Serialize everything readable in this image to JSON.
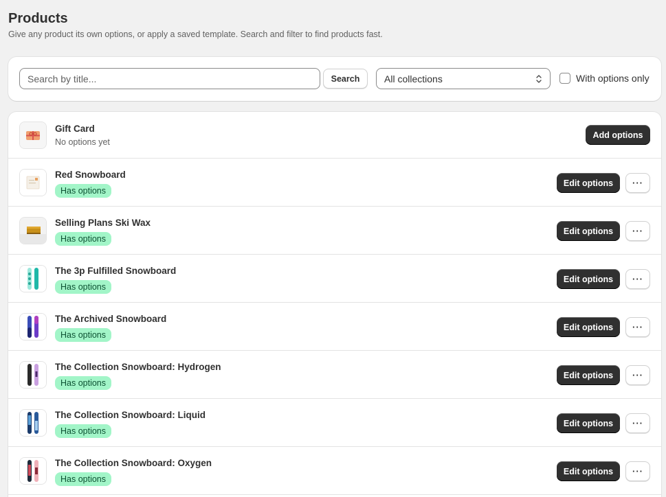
{
  "page": {
    "title": "Products",
    "subtitle": "Give any product its own options, or apply a saved template. Search and filter to find products fast."
  },
  "filters": {
    "search_placeholder": "Search by title...",
    "search_value": "",
    "search_button": "Search",
    "collection_selected": "All collections",
    "checkbox_label": "With options only",
    "checkbox_checked": false
  },
  "icons": {
    "select": "select-chevrons-icon",
    "more": "more-horizontal-icon"
  },
  "products": [
    {
      "title": "Gift Card",
      "status": "No options yet",
      "has_options": false,
      "action": "Add options",
      "thumb": "gift-card"
    },
    {
      "title": "Red Snowboard",
      "status": "Has options",
      "has_options": true,
      "action": "Edit options",
      "more": "···",
      "thumb": "red-snowboard"
    },
    {
      "title": "Selling Plans Ski Wax",
      "status": "Has options",
      "has_options": true,
      "action": "Edit options",
      "more": "···",
      "thumb": "ski-wax"
    },
    {
      "title": "The 3p Fulfilled Snowboard",
      "status": "Has options",
      "has_options": true,
      "action": "Edit options",
      "more": "···",
      "thumb": "3p-snowboard"
    },
    {
      "title": "The Archived Snowboard",
      "status": "Has options",
      "has_options": true,
      "action": "Edit options",
      "more": "···",
      "thumb": "archived-snowboard"
    },
    {
      "title": "The Collection Snowboard: Hydrogen",
      "status": "Has options",
      "has_options": true,
      "action": "Edit options",
      "more": "···",
      "thumb": "hydrogen-snowboard"
    },
    {
      "title": "The Collection Snowboard: Liquid",
      "status": "Has options",
      "has_options": true,
      "action": "Edit options",
      "more": "···",
      "thumb": "liquid-snowboard"
    },
    {
      "title": "The Collection Snowboard: Oxygen",
      "status": "Has options",
      "has_options": true,
      "action": "Edit options",
      "more": "···",
      "thumb": "oxygen-snowboard"
    }
  ],
  "colors": {
    "badge_bg": "#a2f5c8",
    "badge_text": "#0c5132",
    "primary_button": "#303030",
    "page_bg": "#f1f1f1"
  }
}
